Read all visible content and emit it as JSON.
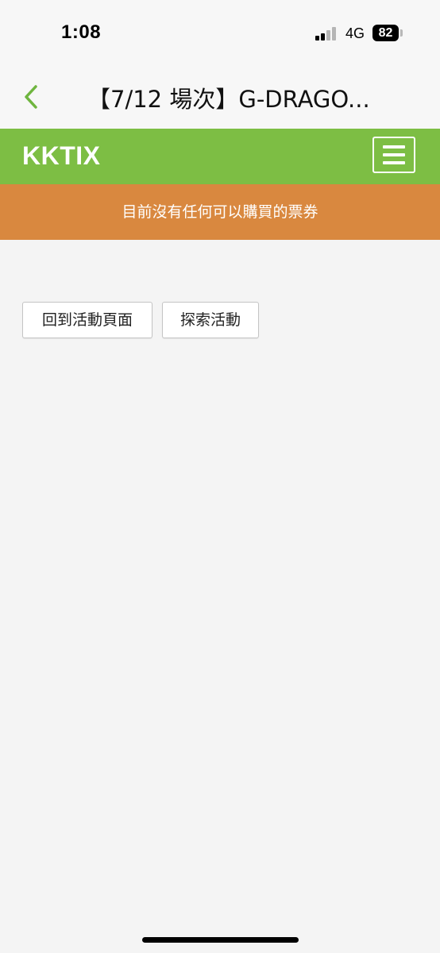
{
  "status_bar": {
    "time": "1:08",
    "network": "4G",
    "battery": "82",
    "signal_bars_active": 2
  },
  "header": {
    "title": "【7/12 場次】G-DRAGO..."
  },
  "brand": {
    "logo": "KKTIX",
    "color": "#7dbe44"
  },
  "alert": {
    "message": "目前沒有任何可以購買的票券",
    "color": "#d9883f"
  },
  "actions": {
    "back_to_event": "回到活動頁面",
    "explore_events": "探索活動"
  },
  "icons": {
    "back": "chevron-left-icon",
    "menu": "hamburger-menu-icon"
  }
}
